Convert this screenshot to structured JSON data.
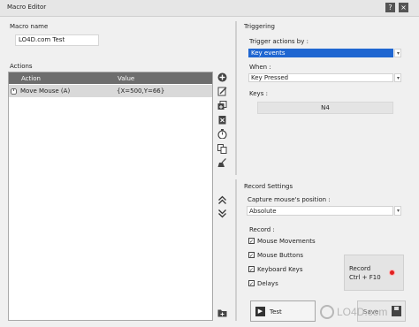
{
  "window": {
    "title": "Macro Editor",
    "help_label": "?",
    "close_label": "×"
  },
  "macro_name": {
    "label": "Macro name",
    "value": "LO4D.com Test"
  },
  "actions": {
    "label": "Actions",
    "columns": [
      "Action",
      "Value"
    ],
    "rows": [
      {
        "action": "Move Mouse (A)",
        "value": "{X=500,Y=66}"
      }
    ]
  },
  "side_tools": [
    "add-icon",
    "edit-icon",
    "duplicate-icon",
    "delete-icon",
    "timer-icon",
    "copy-icon",
    "clear-icon",
    "move-up-icon",
    "move-down-icon",
    "folder-icon"
  ],
  "triggering": {
    "label": "Triggering",
    "trigger_label": "Trigger actions by :",
    "trigger_value": "Key events",
    "when_label": "When :",
    "when_value": "Key Pressed",
    "keys_label": "Keys :",
    "keys_value": "N4"
  },
  "record_settings": {
    "label": "Record Settings",
    "capture_label": "Capture mouse's position :",
    "capture_value": "Absolute",
    "record_label": "Record :",
    "options": [
      {
        "label": "Mouse Movements",
        "checked": true
      },
      {
        "label": "Mouse Buttons",
        "checked": true
      },
      {
        "label": "Keyboard Keys",
        "checked": true
      },
      {
        "label": "Delays",
        "checked": true
      }
    ],
    "record_button_line1": "Record",
    "record_button_line2": "Ctrl + F10"
  },
  "buttons": {
    "test_label": "Test",
    "save_label": "Save"
  },
  "watermark": {
    "text": "LO4D.com"
  },
  "colors": {
    "selection": "#1f66d1",
    "header": "#6d6d6d",
    "record_dot": "#e02020"
  }
}
